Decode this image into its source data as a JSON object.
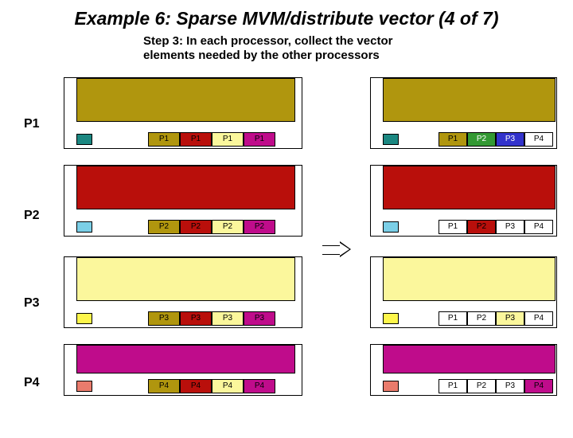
{
  "title": "Example 6: Sparse MVM/distribute vector (4 of 7)",
  "subtitle_l1": "Step 3: In each processor, collect the vector",
  "subtitle_l2": "elements needed by the other processors",
  "rows": {
    "r1": "P1",
    "r2": "P2",
    "r3": "P3",
    "r4": "P4"
  },
  "segs": {
    "p1": "P1",
    "p2": "P2",
    "p3": "P3",
    "p4": "P4"
  }
}
